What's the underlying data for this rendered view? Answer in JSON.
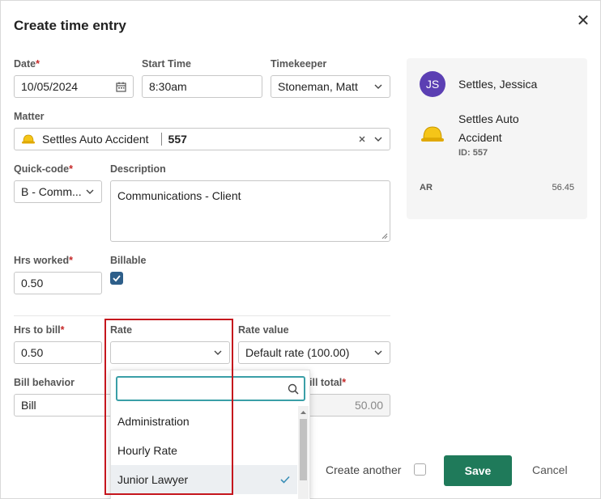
{
  "dialog": {
    "title": "Create time entry",
    "close_glyph": "✕"
  },
  "form": {
    "date": {
      "label": "Date",
      "value": "10/05/2024"
    },
    "start_time": {
      "label": "Start Time",
      "value": "8:30am"
    },
    "timekeeper": {
      "label": "Timekeeper",
      "value": "Stoneman, Matt"
    },
    "matter": {
      "label": "Matter",
      "name": "Settles Auto Accident",
      "number": "557"
    },
    "quick_code": {
      "label": "Quick-code",
      "value": "B - Comm..."
    },
    "description": {
      "label": "Description",
      "value": "Communications - Client"
    },
    "hrs_worked": {
      "label": "Hrs worked",
      "value": "0.50"
    },
    "billable": {
      "label": "Billable",
      "checked": true
    },
    "hrs_to_bill": {
      "label": "Hrs to bill",
      "value": "0.50"
    },
    "rate": {
      "label": "Rate",
      "value": ""
    },
    "rate_value": {
      "label": "Rate value",
      "value": "Default rate (100.00)"
    },
    "bill_behavior": {
      "label": "Bill behavior",
      "value": "Bill"
    },
    "bill_total": {
      "label": "ill total",
      "value": "50.00"
    }
  },
  "rate_dropdown": {
    "search_placeholder": "",
    "options": [
      "Administration",
      "Hourly Rate",
      "Junior Lawyer"
    ],
    "selected": "Junior Lawyer"
  },
  "side_panel": {
    "client_initials": "JS",
    "client_name": "Settles, Jessica",
    "matter_name": "Settles Auto Accident",
    "matter_id": "ID: 557",
    "ar_label": "AR",
    "ar_value": "56.45"
  },
  "footer": {
    "create_another": "Create another",
    "save": "Save",
    "cancel": "Cancel"
  },
  "colors": {
    "accent": "#1f7a5a",
    "checkbox": "#2e5f8a",
    "avatar": "#5b3fb3",
    "highlight": "#c5161d",
    "search_border": "#3a9fa7",
    "required": "#c62828"
  },
  "icons": [
    "close-icon",
    "calendar-icon",
    "chevron-down-icon",
    "hard-hat-icon",
    "clear-icon",
    "search-icon",
    "check-icon"
  ]
}
